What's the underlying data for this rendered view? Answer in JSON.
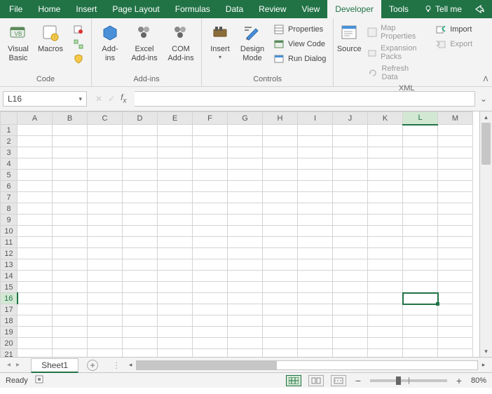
{
  "tabs": {
    "items": [
      "File",
      "Home",
      "Insert",
      "Page Layout",
      "Formulas",
      "Data",
      "Review",
      "View",
      "Developer",
      "Tools"
    ],
    "active": "Developer",
    "tell_me": "Tell me"
  },
  "ribbon": {
    "code": {
      "label": "Code",
      "visual_basic": "Visual\nBasic",
      "macros": "Macros"
    },
    "addins": {
      "label": "Add-ins",
      "addins": "Add-\nins",
      "excel": "Excel\nAdd-ins",
      "com": "COM\nAdd-ins"
    },
    "controls": {
      "label": "Controls",
      "insert": "Insert",
      "design": "Design\nMode",
      "properties": "Properties",
      "view_code": "View Code",
      "run_dialog": "Run Dialog"
    },
    "xml": {
      "label": "XML",
      "source": "Source",
      "map_properties": "Map Properties",
      "expansion_packs": "Expansion Packs",
      "refresh_data": "Refresh Data",
      "import": "Import",
      "export": "Export"
    }
  },
  "formula_bar": {
    "name_box": "L16"
  },
  "grid": {
    "columns": [
      "A",
      "B",
      "C",
      "D",
      "E",
      "F",
      "G",
      "H",
      "I",
      "J",
      "K",
      "L",
      "M"
    ],
    "rows": [
      "1",
      "2",
      "3",
      "4",
      "5",
      "6",
      "7",
      "8",
      "9",
      "10",
      "11",
      "12",
      "13",
      "14",
      "15",
      "16",
      "17",
      "18",
      "19",
      "20",
      "21"
    ],
    "active_col": "L",
    "active_row": "16"
  },
  "sheets": {
    "active": "Sheet1"
  },
  "status": {
    "ready": "Ready",
    "zoom": "80%"
  }
}
